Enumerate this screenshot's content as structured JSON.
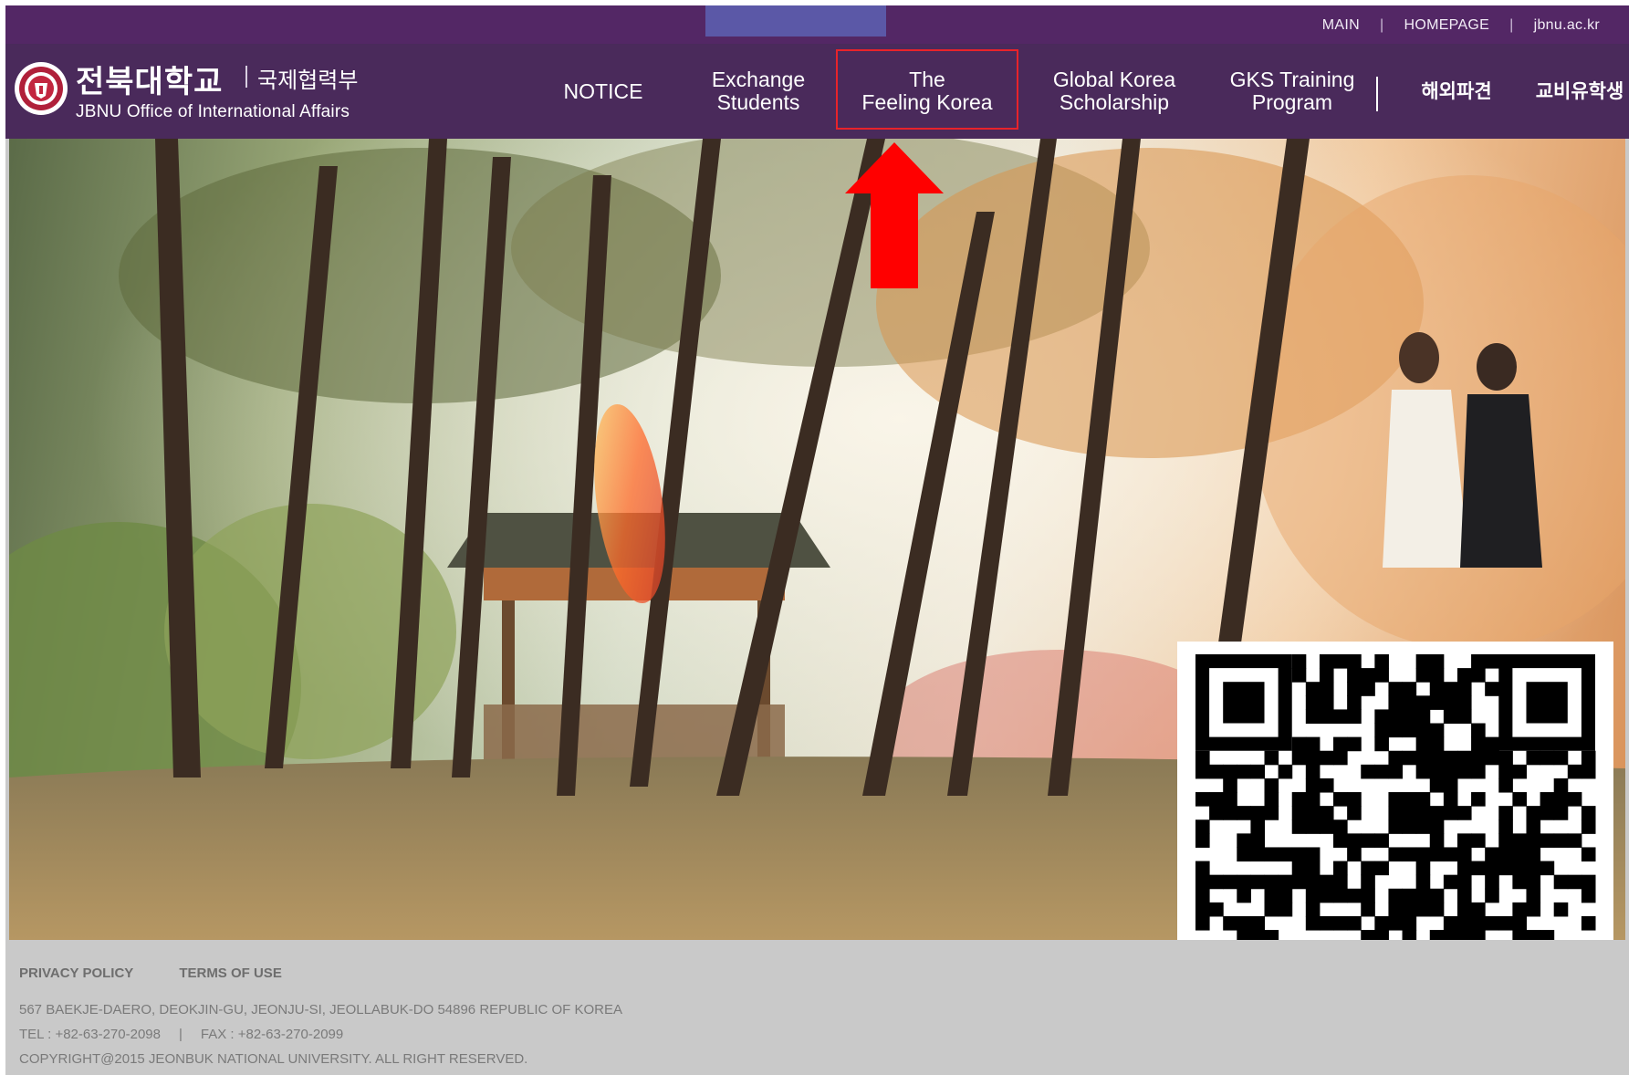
{
  "util_links": {
    "main": "MAIN",
    "homepage": "HOMEPAGE",
    "site": "jbnu.ac.kr",
    "separator": "|"
  },
  "logo": {
    "name_ko": "전북대학교",
    "dept_ko": "국제협력부",
    "name_en": "JBNU Office of International Affairs",
    "icon": "university-seal-icon"
  },
  "nav": {
    "notice": "NOTICE",
    "exchange": "Exchange\nStudents",
    "feeling": "The\nFeeling Korea",
    "gks": "Global Korea\nScholarship",
    "training": "GKS Training\nProgram",
    "dispatch": "해외파견",
    "govt": "교비유학생"
  },
  "annotation": {
    "highlighted_item": "The Feeling Korea",
    "arrow_icon": "red-up-arrow-icon",
    "highlight_color": "#e8232a"
  },
  "hero": {
    "description_icon": "campus-autumn-photo"
  },
  "qr": {
    "icon": "qr-code-icon"
  },
  "footer": {
    "privacy": "PRIVACY POLICY",
    "terms": "TERMS OF USE",
    "address": "567 BAEKJE-DAERO, DEOKJIN-GU, JEONJU-SI, JEOLLABUK-DO 54896 REPUBLIC OF KOREA",
    "tel": "TEL : +82-63-270-2098",
    "contact_separator": "|",
    "fax": "FAX : +82-63-270-2099",
    "copyright": "COPYRIGHT@2015 JEONBUK NATIONAL UNIVERSITY. ALL RIGHT RESERVED."
  },
  "colors": {
    "header_bg": "#4a2a5b",
    "topbar_bg": "#532765",
    "footer_bg": "#c9c9c9"
  }
}
